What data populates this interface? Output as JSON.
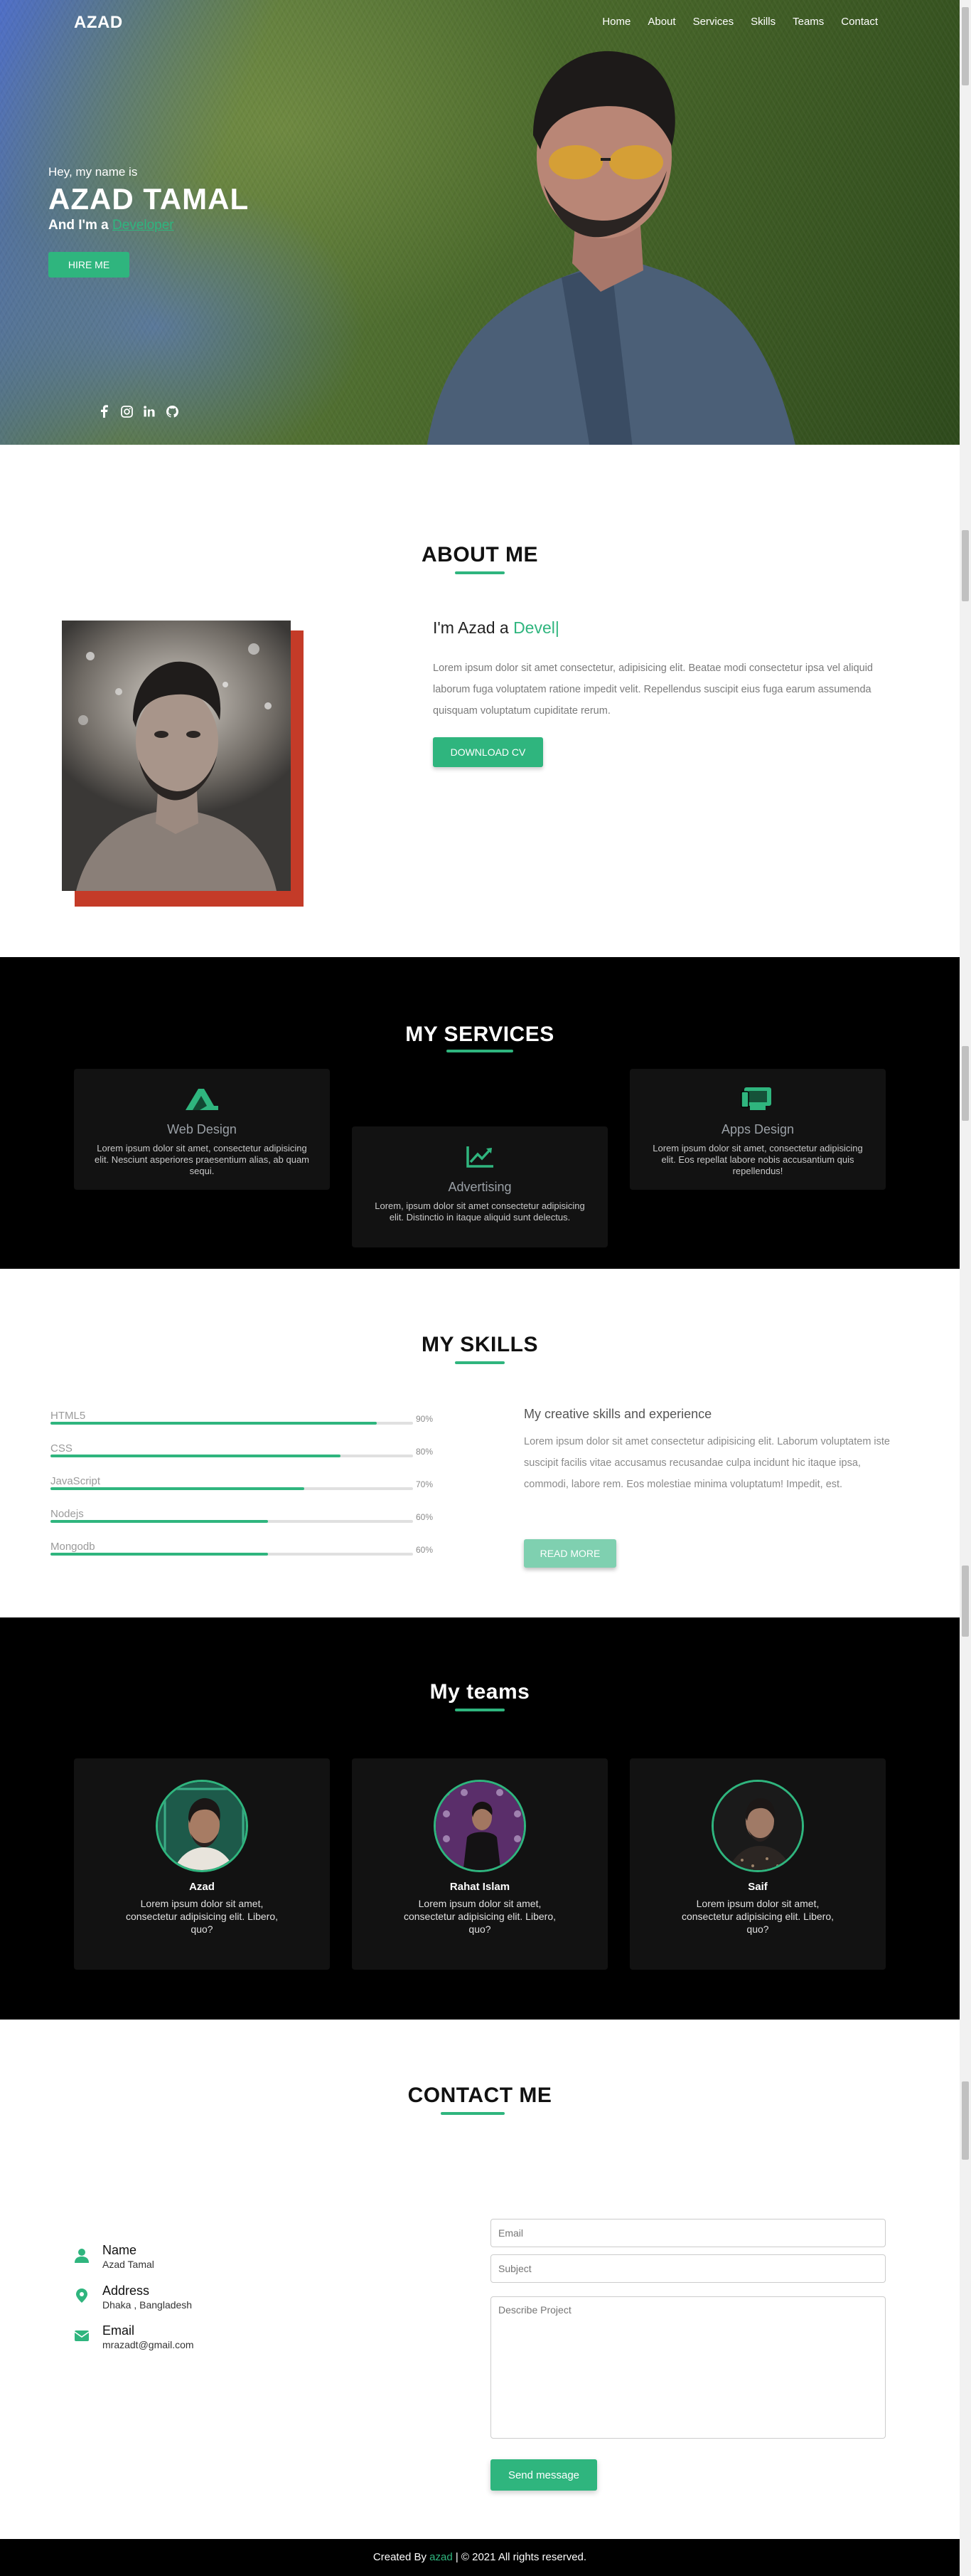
{
  "nav": {
    "brand": "AZAD",
    "links": [
      "Home",
      "About",
      "Services",
      "Skills",
      "Teams",
      "Contact"
    ]
  },
  "hero": {
    "greeting": "Hey, my name is",
    "name": "AZAD TAMAL",
    "role_prefix": "And I'm a",
    "role_typed": "Developer",
    "hire_label": "HIRE ME",
    "socials": [
      "facebook-icon",
      "instagram-icon",
      "linkedin-icon",
      "github-icon"
    ]
  },
  "about": {
    "title": "ABOUT ME",
    "heading_prefix": "I'm Azad a",
    "heading_typed": "Devel",
    "paragraph": "Lorem ipsum dolor sit amet consectetur, adipisicing elit. Beatae modi consectetur ipsa vel aliquid laborum fuga voluptatem ratione impedit velit. Repellendus suscipit eius fuga earum assumenda quisquam voluptatum cupiditate rerum.",
    "download_label": "DOWNLOAD CV"
  },
  "services": {
    "title": "MY SERVICES",
    "items": [
      {
        "name": "Web Design",
        "desc": "Lorem ipsum dolor sit amet, consectetur adipisicing elit. Nesciunt asperiores praesentium alias, ab quam sequi."
      },
      {
        "name": "Advertising",
        "desc": "Lorem, ipsum dolor sit amet consectetur adipisicing elit. Distinctio in itaque aliquid sunt delectus."
      },
      {
        "name": "Apps Design",
        "desc": "Lorem ipsum dolor sit amet, consectetur adipisicing elit. Eos repellat labore nobis accusantium quis repellendus!"
      }
    ]
  },
  "skills": {
    "title": "MY SKILLS",
    "items": [
      {
        "name": "HTML5",
        "percent": 90,
        "label": "90%"
      },
      {
        "name": "CSS",
        "percent": 80,
        "label": "80%"
      },
      {
        "name": "JavaScript",
        "percent": 70,
        "label": "70%"
      },
      {
        "name": "Nodejs",
        "percent": 60,
        "label": "60%"
      },
      {
        "name": "Mongodb",
        "percent": 60,
        "label": "60%"
      }
    ],
    "heading": "My creative skills and experience",
    "paragraph": "Lorem ipsum dolor sit amet consectetur adipisicing elit. Laborum voluptatem iste suscipit facilis vitae accusamus recusandae culpa incidunt hic itaque ipsa, commodi, labore rem. Eos molestiae minima voluptatum! Impedit, est.",
    "readmore_label": "READ MORE"
  },
  "teams": {
    "title": "My teams",
    "members": [
      {
        "name": "Azad",
        "desc": "Lorem ipsum dolor sit amet, consectetur adipisicing elit. Libero, quo?"
      },
      {
        "name": "Rahat Islam",
        "desc": "Lorem ipsum dolor sit amet, consectetur adipisicing elit. Libero, quo?"
      },
      {
        "name": "Saif",
        "desc": "Lorem ipsum dolor sit amet, consectetur adipisicing elit. Libero, quo?"
      }
    ]
  },
  "contact": {
    "title": "CONTACT ME",
    "info": [
      {
        "label": "Name",
        "value": "Azad Tamal",
        "icon": "user-icon"
      },
      {
        "label": "Address",
        "value": "Dhaka , Bangladesh",
        "icon": "location-icon"
      },
      {
        "label": "Email",
        "value": "mrazadt@gmail.com",
        "icon": "envelope-icon"
      }
    ],
    "email_placeholder": "Email",
    "subject_placeholder": "Subject",
    "message_placeholder": "Describe Project",
    "send_label": "Send message"
  },
  "footer": {
    "prefix": "Created By",
    "author": "azad",
    "suffix": "| © 2021 All rights reserved."
  },
  "colors": {
    "accent": "#2fb57e",
    "dark_bg": "#000000",
    "card_bg": "#121212"
  }
}
